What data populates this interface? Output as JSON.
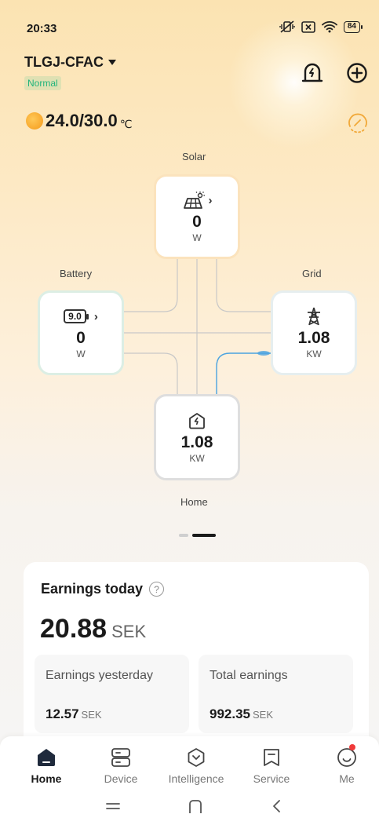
{
  "status_bar": {
    "time": "20:33",
    "battery": "84"
  },
  "header": {
    "station_name": "TLGJ-CFAC",
    "station_status": "Normal"
  },
  "weather": {
    "temp": "24.0/30.0",
    "unit": "℃"
  },
  "flow": {
    "solar": {
      "label": "Solar",
      "value": "0",
      "unit": "W"
    },
    "battery": {
      "label": "Battery",
      "soc": "9.0",
      "value": "0",
      "unit": "W"
    },
    "grid": {
      "label": "Grid",
      "value": "1.08",
      "unit": "KW"
    },
    "home": {
      "label": "Home",
      "value": "1.08",
      "unit": "KW"
    }
  },
  "earnings": {
    "title": "Earnings today",
    "today_value": "20.88",
    "currency": "SEK",
    "yesterday_label": "Earnings yesterday",
    "yesterday_value": "12.57",
    "total_label": "Total earnings",
    "total_value": "992.35"
  },
  "nav": {
    "home": "Home",
    "device": "Device",
    "intelligence": "Intelligence",
    "service": "Service",
    "me": "Me"
  },
  "colors": {
    "accent_green": "#21b47c",
    "grid_flow": "#4aa3e0",
    "badge": "#f03a3a"
  }
}
